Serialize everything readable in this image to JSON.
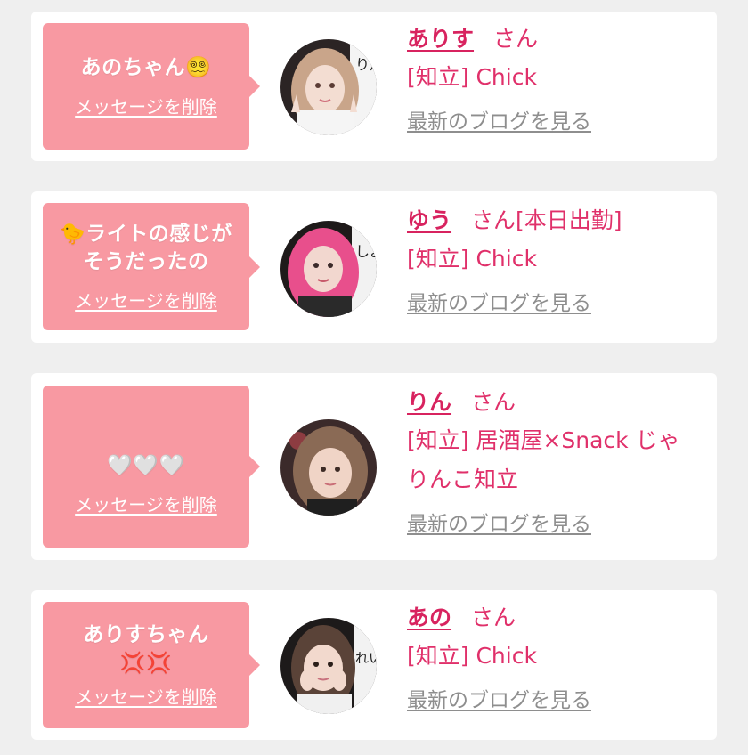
{
  "cards": [
    {
      "message_line1": "あのちゃん😵‍💫",
      "message_line2": "",
      "delete_label": "メッセージを削除",
      "name": "ありす",
      "suffix": "さん",
      "shop": "[知立] Chick",
      "blog_label": "最新のブログを見る",
      "avatar_colors": {
        "hair": "#c9a58a",
        "bg": "#2b2424",
        "skin": "#f3ddd2"
      }
    },
    {
      "message_line1": "🐤ライトの感じが",
      "message_line2": "そうだったの",
      "delete_label": "メッセージを削除",
      "name": "ゆう",
      "suffix": "さん[本日出勤]",
      "shop": "[知立] Chick",
      "blog_label": "最新のブログを見る",
      "avatar_colors": {
        "hair": "#e84f8c",
        "bg": "#1e1a1a",
        "skin": "#f2d7cf"
      }
    },
    {
      "message_line1": "🤍🤍🤍",
      "message_line2": "",
      "delete_label": "メッセージを削除",
      "name": "りん",
      "suffix": "さん",
      "shop": "[知立] 居酒屋×Snack じゃりんこ知立",
      "blog_label": "最新のブログを見る",
      "avatar_colors": {
        "hair": "#8a6a55",
        "bg": "#3b2a2a",
        "skin": "#f0d4c6"
      }
    },
    {
      "message_line1": "ありすちゃん",
      "message_line2": "💢💢",
      "delete_label": "メッセージを削除",
      "name": "あの",
      "suffix": "さん",
      "shop": "[知立] Chick",
      "blog_label": "最新のブログを見る",
      "avatar_colors": {
        "hair": "#5a4338",
        "bg": "#1d1a1a",
        "skin": "#f2d9cd"
      }
    }
  ]
}
